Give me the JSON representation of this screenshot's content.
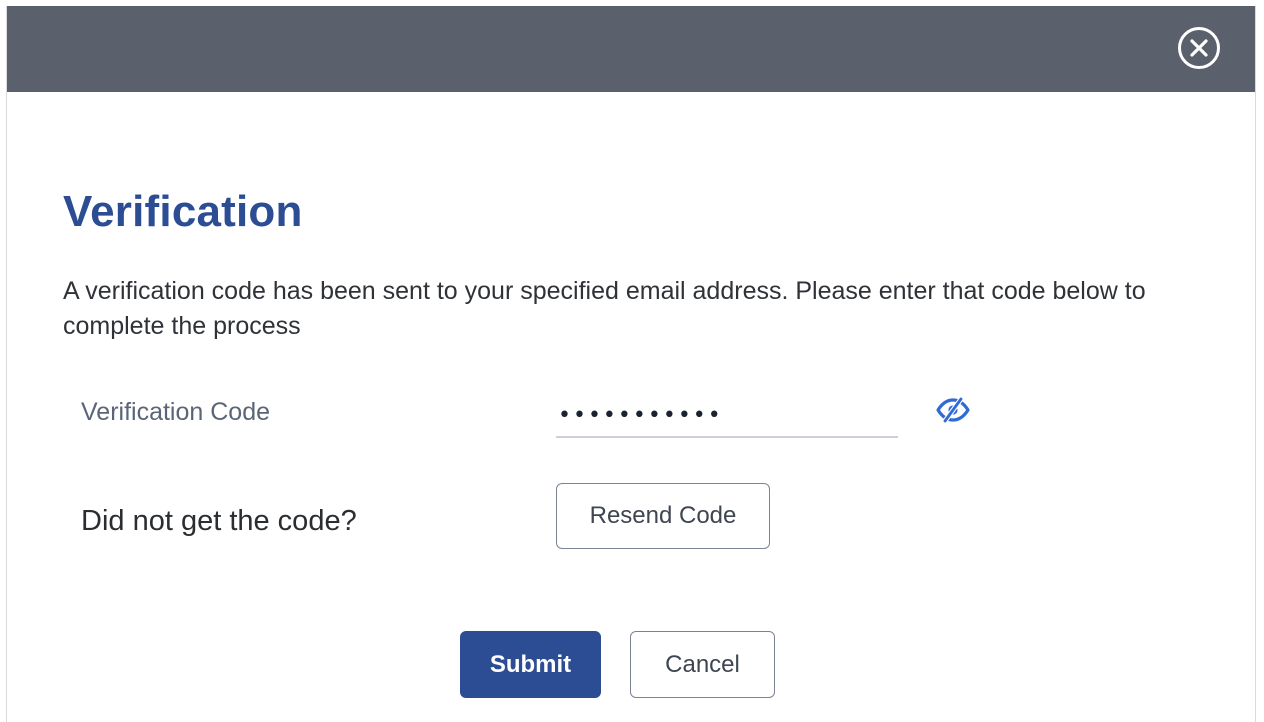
{
  "dialog": {
    "close_icon": "close-circle-icon",
    "title": "Verification",
    "description": "A verification code has been sent to your specified email address. Please enter that code below to complete the process"
  },
  "form": {
    "code_label": "Verification Code",
    "code_value": "•••••••••••",
    "eye_icon": "eye-slash-icon",
    "resend_prompt": "Did not get the code?",
    "resend_label": "Resend Code"
  },
  "actions": {
    "submit_label": "Submit",
    "cancel_label": "Cancel"
  },
  "colors": {
    "header_bg": "#5a616d",
    "primary": "#2c4d93",
    "eye_icon": "#2f6bd6"
  }
}
